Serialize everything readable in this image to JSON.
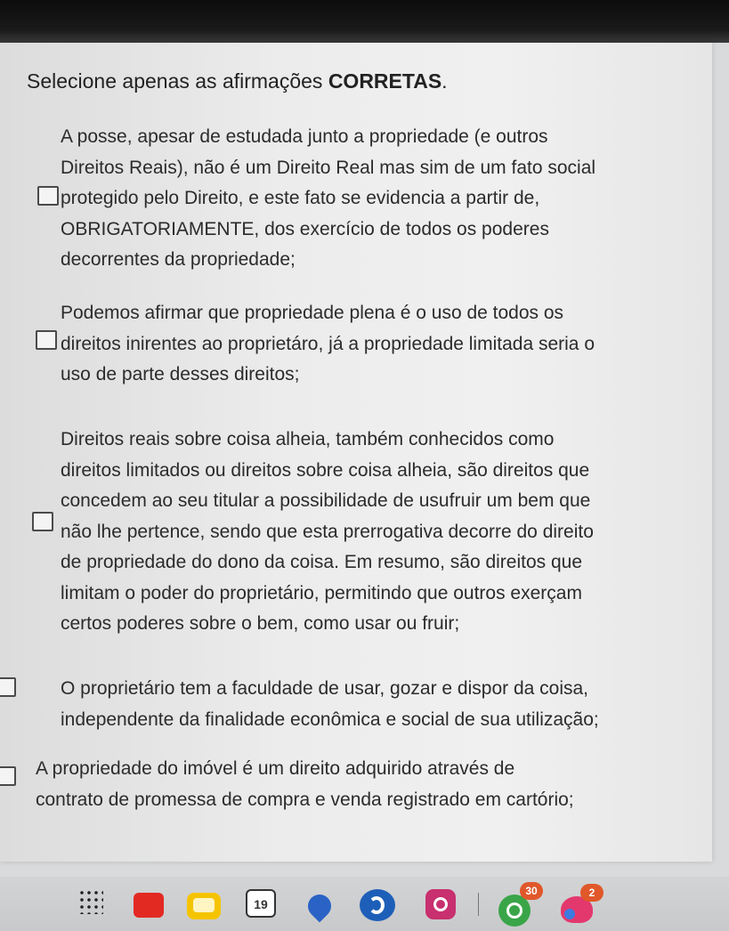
{
  "question": {
    "title_prefix": "Selecione apenas as afirmações ",
    "title_emphasis": "CORRETAS",
    "title_suffix": "."
  },
  "options": [
    {
      "lines": [
        "A posse, apesar de estudada junto a propriedade (e outros",
        "Direitos Reais), não é um Direito Real mas sim de um fato social",
        "protegido pelo Direito, e este fato se evidencia a partir de,",
        "OBRIGATORIAMENTE, dos exercício de todos os poderes",
        "decorrentes da propriedade;"
      ],
      "checked": false
    },
    {
      "lines": [
        "Podemos afirmar que propriedade plena é o uso de todos os",
        "direitos inirentes ao proprietáro, já a propriedade limitada seria o",
        "uso de parte desses direitos;"
      ],
      "checked": false
    },
    {
      "lines": [
        "Direitos reais sobre coisa alheia, também conhecidos como",
        "direitos limitados ou direitos sobre coisa alheia, são direitos que",
        "concedem ao seu titular a possibilidade de usufruir um bem que",
        "não lhe pertence, sendo que esta prerrogativa decorre do direito",
        "de propriedade do dono da coisa. Em resumo, são direitos que",
        "limitam o poder do proprietário, permitindo que outros exerçam",
        "certos poderes sobre o bem, como usar ou fruir;"
      ],
      "checked": false
    },
    {
      "lines": [
        "O proprietário tem a faculdade de usar, gozar e dispor da coisa,",
        "independente da finalidade econômica e social de sua utilização;"
      ],
      "checked": false
    },
    {
      "lines": [
        "A propriedade do imóvel é um direito adquirido através de",
        "contrato de promessa de compra e venda registrado em cartório;"
      ],
      "checked": false
    }
  ],
  "taskbar": {
    "icons": [
      "apps-grid-icon",
      "red-app-icon",
      "notes-icon",
      "calendar-icon",
      "maps-pin-icon",
      "edge-browser-icon",
      "instagram-icon",
      "whatsapp-icon",
      "pink-app-icon"
    ],
    "calendar_day": "19",
    "whatsapp_badge": "30",
    "pink_app_badge": "2"
  },
  "colors": {
    "card_background": "#ececec",
    "text": "#2b2b2b",
    "checkbox_border": "#4a4a4a",
    "badge": "#e0582a"
  }
}
